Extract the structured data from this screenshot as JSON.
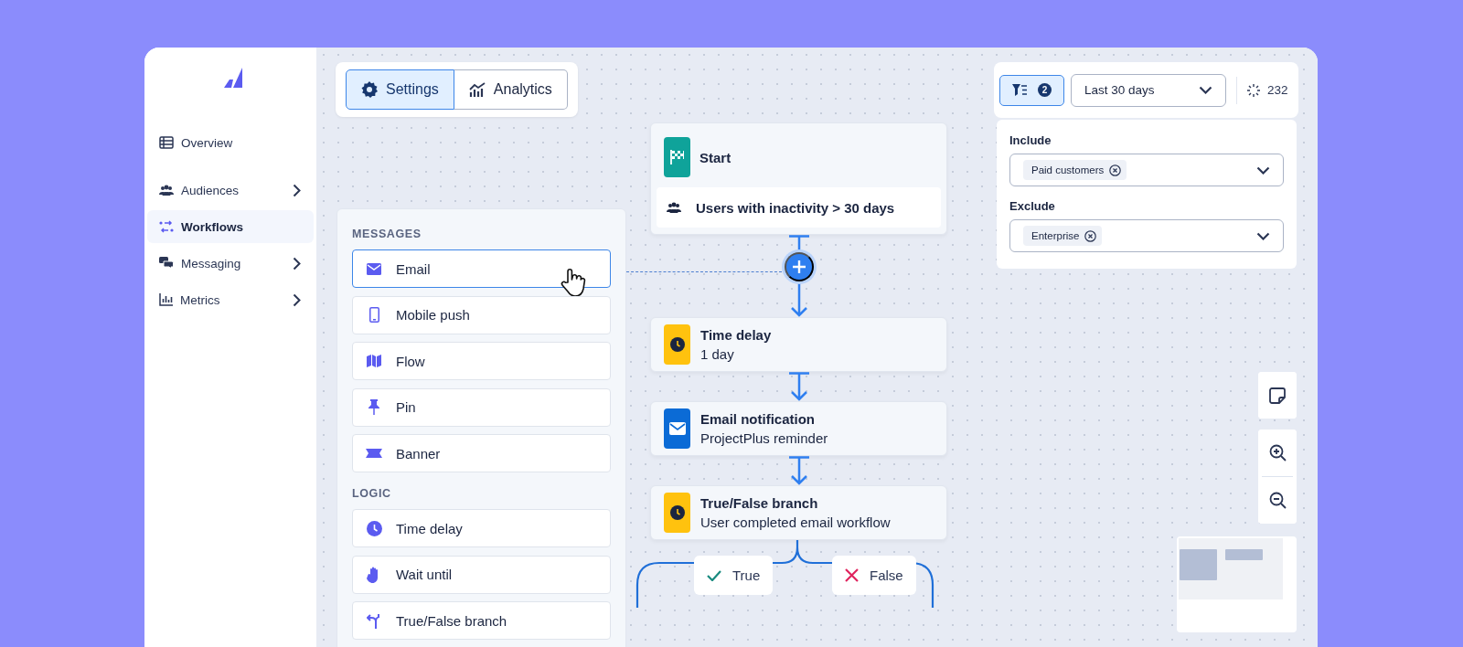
{
  "sidebar": {
    "items": [
      {
        "label": "Overview",
        "selected": false,
        "expandable": false
      },
      {
        "label": "Audiences",
        "selected": false,
        "expandable": true
      },
      {
        "label": "Workflows",
        "selected": true,
        "expandable": false
      },
      {
        "label": "Messaging",
        "selected": false,
        "expandable": true
      },
      {
        "label": "Metrics",
        "selected": false,
        "expandable": true
      }
    ]
  },
  "view_tabs": [
    {
      "label": "Settings",
      "selected": true
    },
    {
      "label": "Analytics",
      "selected": false
    }
  ],
  "palette": {
    "sections": [
      {
        "heading": "MESSAGES",
        "items": [
          {
            "label": "Email",
            "selected": true
          },
          {
            "label": "Mobile push",
            "selected": false
          },
          {
            "label": "Flow",
            "selected": false
          },
          {
            "label": "Pin",
            "selected": false
          },
          {
            "label": "Banner",
            "selected": false
          }
        ]
      },
      {
        "heading": "LOGIC",
        "items": [
          {
            "label": "Time delay",
            "selected": false
          },
          {
            "label": "Wait until",
            "selected": false
          },
          {
            "label": "True/False branch",
            "selected": false
          }
        ]
      }
    ]
  },
  "flow": {
    "nodes": [
      {
        "kind": "start",
        "title": "Start",
        "audience": "Users with inactivity > 30 days"
      },
      {
        "kind": "delay",
        "title": "Time delay",
        "subtitle": "1 day"
      },
      {
        "kind": "email",
        "title": "Email notification",
        "subtitle": "ProjectPlus reminder"
      },
      {
        "kind": "branch",
        "title": "True/False branch",
        "subtitle": "User completed email workflow"
      }
    ],
    "branches": [
      {
        "kind": "true",
        "label": "True"
      },
      {
        "kind": "false",
        "label": "False"
      }
    ]
  },
  "toolbar": {
    "filter_count": "2",
    "date_range": "Last 30 days",
    "count": "232"
  },
  "filters": [
    {
      "label": "Include",
      "tags": [
        "Paid customers"
      ]
    },
    {
      "label": "Exclude",
      "tags": [
        "Enterprise"
      ]
    }
  ]
}
